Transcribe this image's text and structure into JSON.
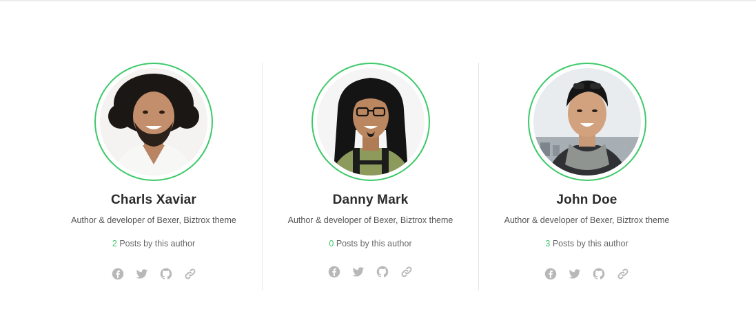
{
  "section": {
    "authors": [
      {
        "name": "Charls Xaviar",
        "bio": "Author & developer of Bexer, Biztrox theme",
        "post_count": "2",
        "posts_suffix": "Posts by this author",
        "socials": [
          "facebook-icon",
          "twitter-icon",
          "github-icon",
          "link-icon"
        ]
      },
      {
        "name": "Danny Mark",
        "bio": "Author & developer of Bexer, Biztrox theme",
        "post_count": "0",
        "posts_suffix": "Posts by this author",
        "socials": [
          "facebook-icon",
          "twitter-icon",
          "github-icon",
          "link-icon"
        ]
      },
      {
        "name": "John Doe",
        "bio": "Author & developer of Bexer, Biztrox theme",
        "post_count": "3",
        "posts_suffix": "Posts by this author",
        "socials": [
          "facebook-icon",
          "twitter-icon",
          "github-icon",
          "link-icon"
        ]
      }
    ]
  },
  "colors": {
    "accent": "#3ec96a",
    "icon": "#b8b8b8",
    "divider": "#e6e6e6"
  }
}
